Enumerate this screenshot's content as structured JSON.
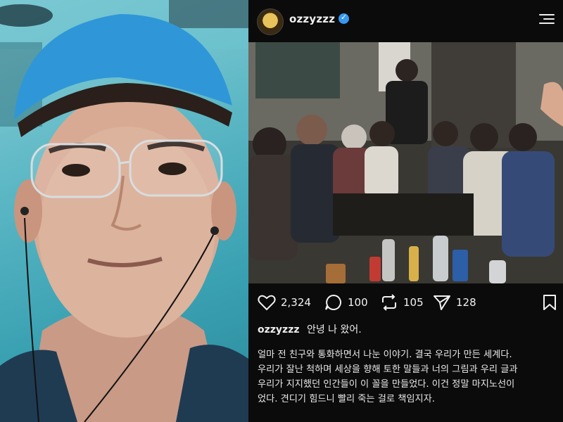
{
  "post": {
    "username": "ozzyzzz",
    "verified_icon": "check-icon",
    "menu_icon": "hamburger-menu-icon",
    "stats": {
      "likes": "2,324",
      "comments": "100",
      "reposts": "105",
      "shares": "128"
    },
    "caption_title": "안녕 나 왔어.",
    "caption_lines": [
      "얼마 전 친구와 통화하면서 나눈 이야기. 결국 우리가 만든 세계다.",
      "우리가 잘난 척하며 세상을 향해 토한 말들과 너의 그림과 우리 글과",
      "우리가 지지했던 인간들이 이 꼴을 만들었다. 이건 정말 마지노선이",
      "었다. 견디기 힘드니 빨리 죽는 걸로 책임지자."
    ]
  },
  "colors": {
    "background": "#0b0b0b",
    "verified": "#3897f0",
    "cap": "#2f97d8"
  }
}
